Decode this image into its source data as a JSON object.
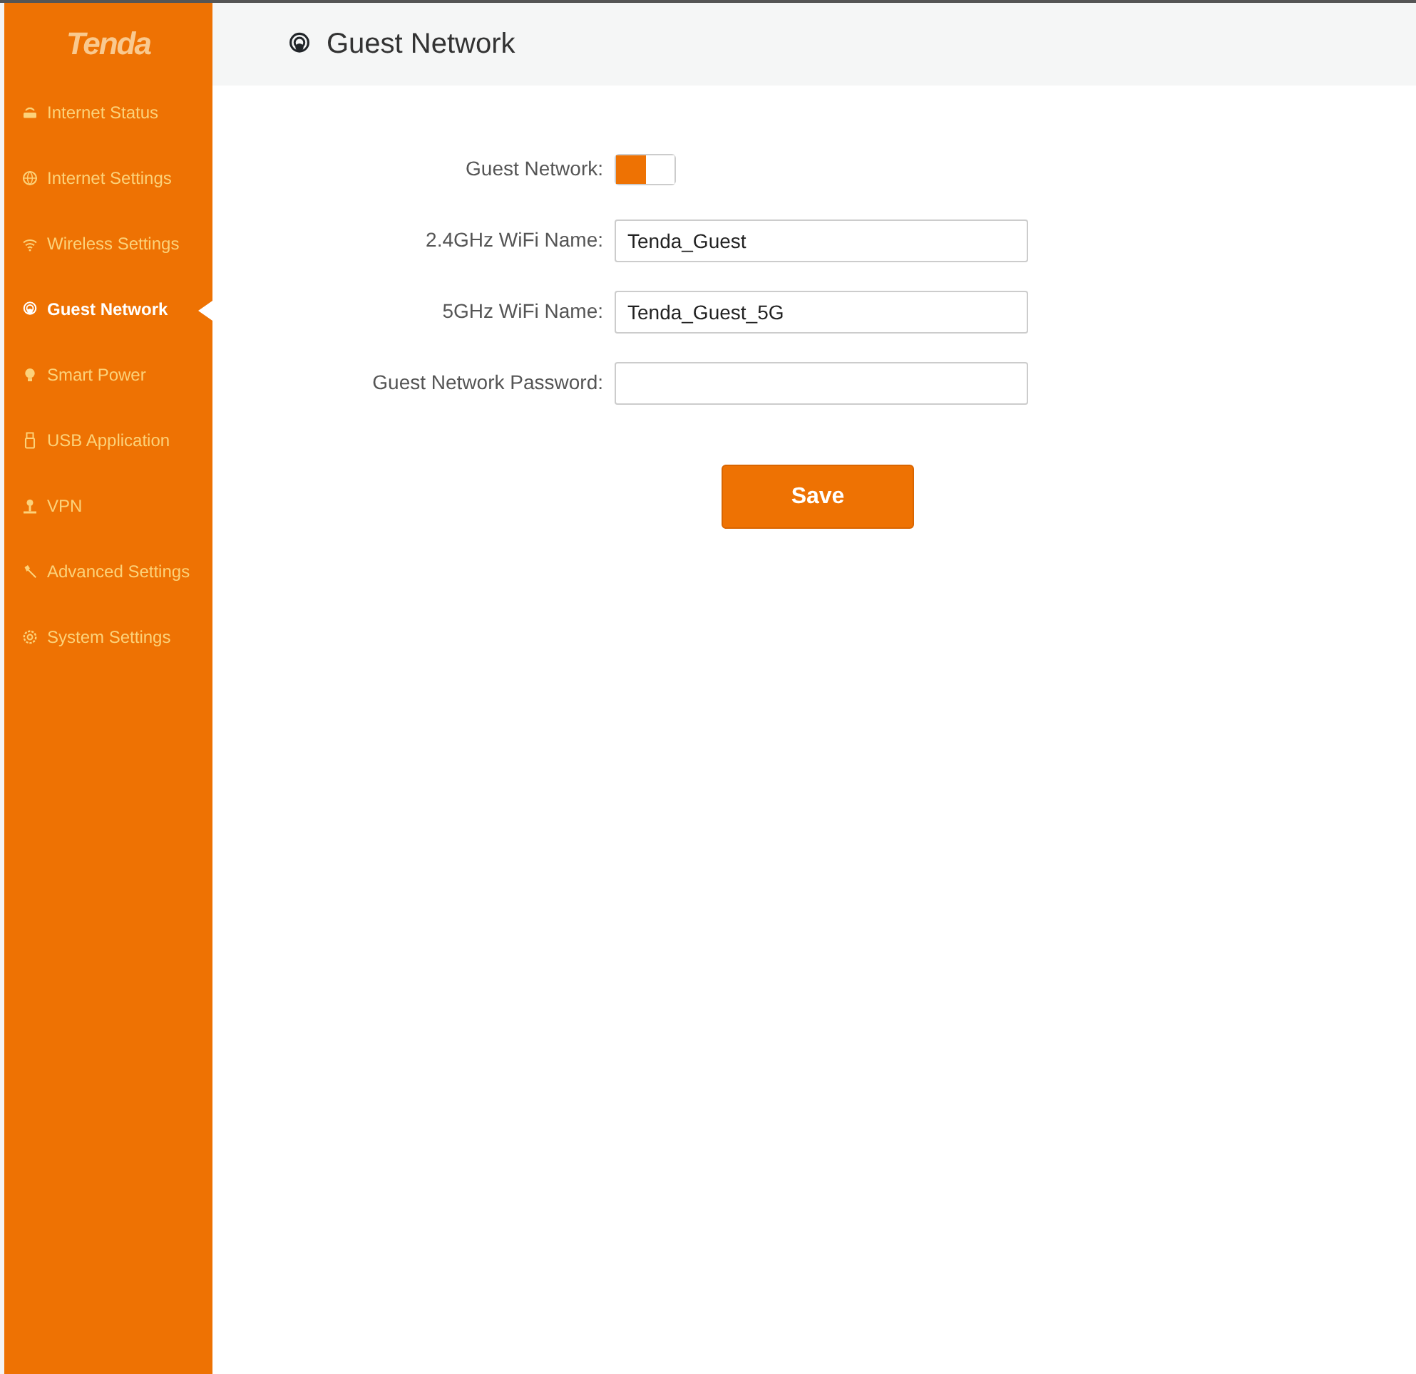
{
  "sidebar": {
    "logo": "Tenda",
    "items": [
      {
        "label": "Internet Status",
        "kind": "router",
        "selected": false
      },
      {
        "label": "Internet Settings",
        "kind": "globe",
        "selected": false
      },
      {
        "label": "Wireless Settings",
        "kind": "wifi",
        "selected": false
      },
      {
        "label": "Guest Network",
        "kind": "hotspot",
        "selected": true
      },
      {
        "label": "Smart Power",
        "kind": "bulb",
        "selected": false
      },
      {
        "label": "USB Application",
        "kind": "usb",
        "selected": false
      },
      {
        "label": "VPN",
        "kind": "vpn",
        "selected": false
      },
      {
        "label": "Advanced Settings",
        "kind": "tool",
        "selected": false
      },
      {
        "label": "System Settings",
        "kind": "gear",
        "selected": false
      }
    ]
  },
  "header": {
    "title": "Guest Network"
  },
  "form": {
    "fields": [
      {
        "kind": "toggle",
        "label": "Guest Network:",
        "on": true
      },
      {
        "kind": "text",
        "label": "2.4GHz WiFi Name:",
        "value": "Tenda_Guest"
      },
      {
        "kind": "text",
        "label": "5GHz WiFi Name:",
        "value": "Tenda_Guest_5G"
      },
      {
        "kind": "text",
        "label": "Guest Network Password:"
      }
    ],
    "save_button": "Save"
  }
}
